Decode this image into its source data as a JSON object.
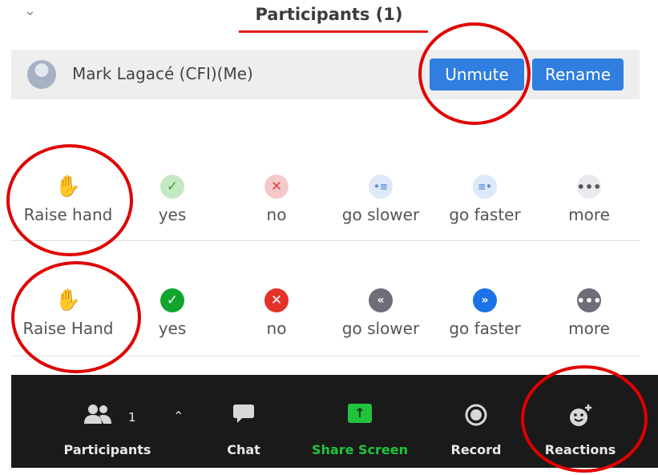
{
  "header": {
    "title": "Participants (1)",
    "collapse_icon": "chevron-down-icon"
  },
  "participant": {
    "name": "Mark Lagacé (CFI)(Me)",
    "unmute_label": "Unmute",
    "rename_label": "Rename"
  },
  "reactions_light": [
    {
      "label": "Raise hand",
      "icon": "hand-icon",
      "glyph": "✋"
    },
    {
      "label": "yes",
      "icon": "check-icon",
      "glyph": "✓"
    },
    {
      "label": "no",
      "icon": "x-icon",
      "glyph": "✕"
    },
    {
      "label": "go slower",
      "icon": "slower-icon",
      "glyph": "•≡"
    },
    {
      "label": "go faster",
      "icon": "faster-icon",
      "glyph": "≡•"
    },
    {
      "label": "more",
      "icon": "more-icon",
      "glyph": "•••"
    }
  ],
  "reactions_solid": [
    {
      "label": "Raise Hand",
      "icon": "hand-icon",
      "glyph": "✋"
    },
    {
      "label": "yes",
      "icon": "check-icon",
      "glyph": "✓"
    },
    {
      "label": "no",
      "icon": "x-icon",
      "glyph": "✕"
    },
    {
      "label": "go slower",
      "icon": "rewind-icon",
      "glyph": "«"
    },
    {
      "label": "go faster",
      "icon": "fast-forward-icon",
      "glyph": "»"
    },
    {
      "label": "more",
      "icon": "more-icon",
      "glyph": "•••"
    }
  ],
  "toolbar": {
    "participants_label": "Participants",
    "participants_count": "1",
    "chat_label": "Chat",
    "share_label": "Share Screen",
    "record_label": "Record",
    "reactions_label": "Reactions"
  },
  "colors": {
    "accent_blue": "#2f7ee0",
    "annotation_red": "#e00000",
    "share_green": "#21c33c",
    "toolbar_bg": "#1a1a1a"
  }
}
